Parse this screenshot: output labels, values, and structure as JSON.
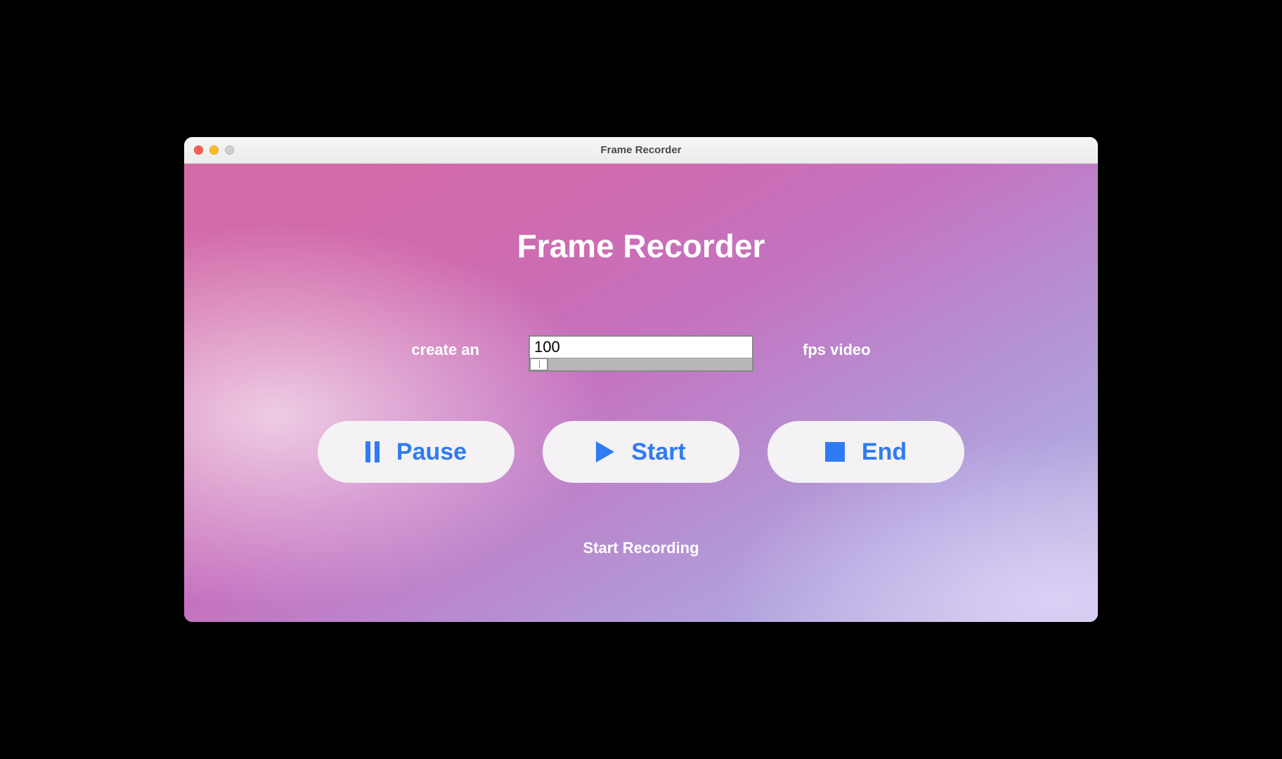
{
  "window": {
    "title": "Frame Recorder"
  },
  "heading": "Frame Recorder",
  "fps": {
    "prefix": "create an",
    "value": "100",
    "suffix": "fps video"
  },
  "buttons": {
    "pause": "Pause",
    "start": "Start",
    "end": "End"
  },
  "status": "Start Recording"
}
